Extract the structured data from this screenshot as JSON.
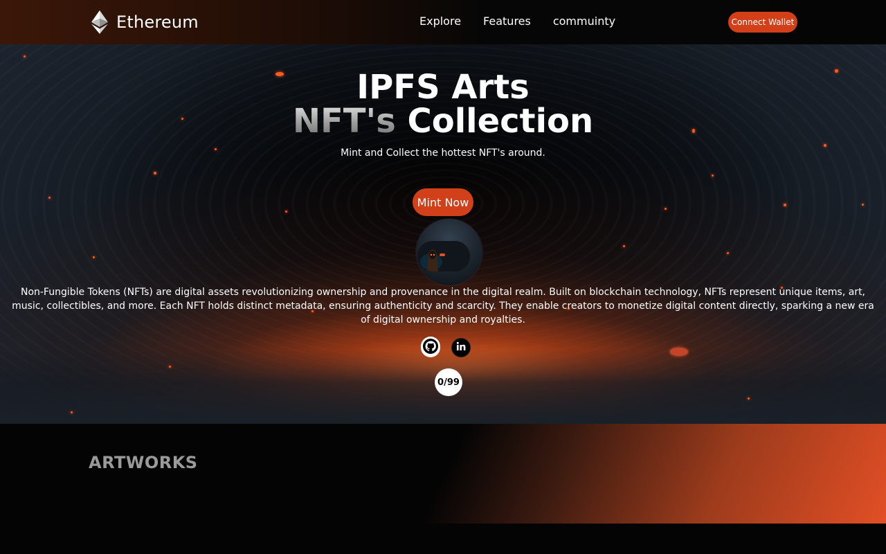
{
  "nav": {
    "brand": "Ethereum",
    "brand_icon": "ethereum-icon",
    "links": [
      "Explore",
      "Features",
      "commuinty"
    ],
    "connect_label": "Connect Wallet"
  },
  "hero": {
    "title_line1": "IPFS Arts",
    "title_line2_highlight": "NFT's",
    "title_line2_rest": "Collection",
    "subtitle": "Mint and Collect the hottest NFT's around.",
    "mint_label": "Mint Now",
    "description": "Non-Fungible Tokens (NFTs) are digital assets revolutionizing ownership and provenance in the digital realm. Built on blockchain technology, NFTs represent unique items, art, music, collectibles, and more. Each NFT holds distinct metadata, ensuring authenticity and scarcity. They enable creators to monetize digital content directly, sparking a new era of digital ownership and royalties.",
    "social_icons": [
      "github-icon",
      "linkedin-icon"
    ],
    "counter": "0/99"
  },
  "artworks": {
    "title": "ARTWORKS"
  },
  "colors": {
    "accent": "#d2401a",
    "background": "#040404",
    "gradient_end": "#e24f25"
  }
}
